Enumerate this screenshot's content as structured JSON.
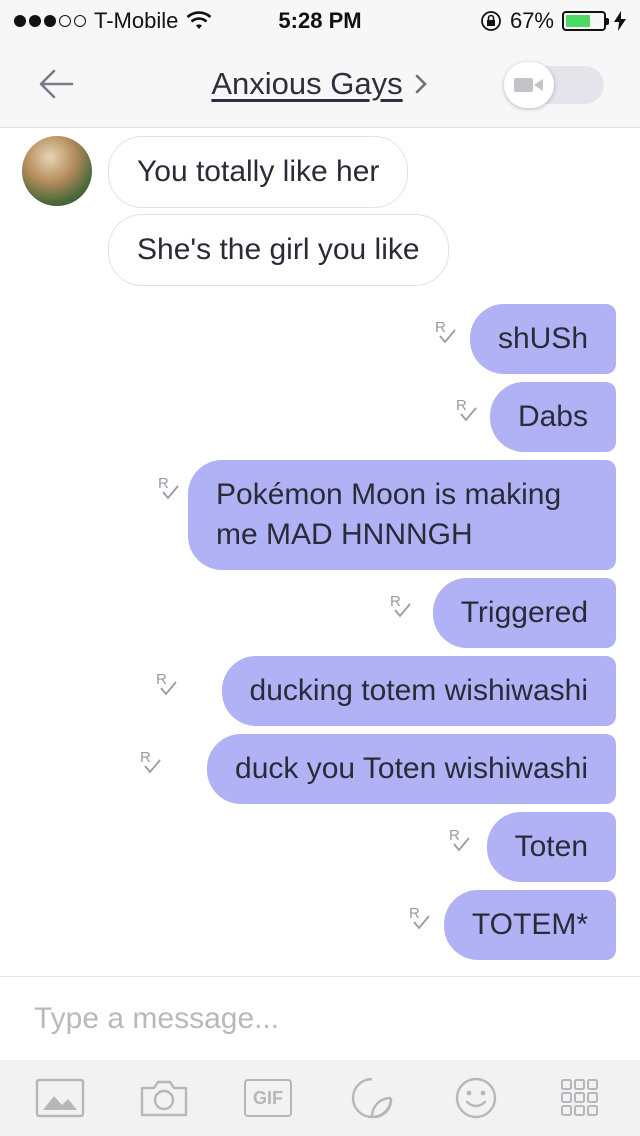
{
  "status_bar": {
    "carrier": "T-Mobile",
    "time": "5:28 PM",
    "battery": "67%",
    "battery_level": 0.67,
    "signal_dots_filled": 3,
    "signal_dots_total": 5
  },
  "header": {
    "title": "Anxious Gays",
    "back_icon": "back-arrow-icon",
    "video_icon": "video-camera-icon"
  },
  "messages": [
    {
      "direction": "in",
      "text": "You totally like her"
    },
    {
      "direction": "in",
      "text": "She's the girl you like"
    },
    {
      "direction": "out",
      "text": "shUSh"
    },
    {
      "direction": "out",
      "text": "Dabs"
    },
    {
      "direction": "out",
      "text": "Pokémon Moon is making me MAD HNNNGH"
    },
    {
      "direction": "out",
      "text": "Triggered"
    },
    {
      "direction": "out",
      "text": "ducking totem wishiwashi"
    },
    {
      "direction": "out",
      "text": "duck you Toten wishiwashi"
    },
    {
      "direction": "out",
      "text": "Toten"
    },
    {
      "direction": "out",
      "text": "TOTEM*"
    }
  ],
  "receipt_label": "R",
  "input": {
    "placeholder": "Type a message..."
  },
  "toolbar": {
    "gif_label": "GIF",
    "icons": [
      "image-icon",
      "camera-icon",
      "gif-icon",
      "sticker-icon",
      "emoji-icon",
      "more-grid-icon"
    ]
  },
  "colors": {
    "outgoing_bubble": "#b0b2f5",
    "incoming_bubble": "#ffffff",
    "battery_fill": "#4cd964"
  }
}
